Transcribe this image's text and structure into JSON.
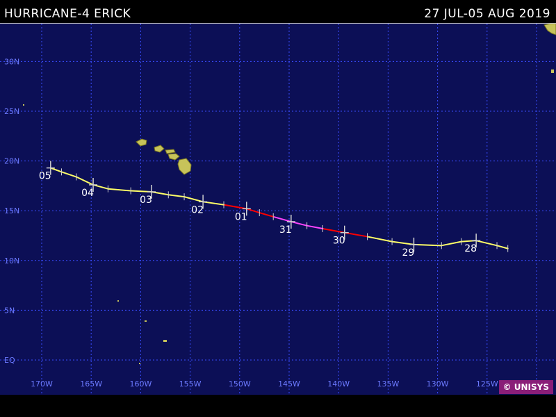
{
  "header": {
    "title": "HURRICANE-4 ERICK",
    "date_range": "27 JUL-05 AUG 2019"
  },
  "credit": "© UNISYS",
  "colors": {
    "ocean": "#0c0f56",
    "grid": "#3a4cff",
    "land": "#c7c35a",
    "hurricane": "#ff0000",
    "category_4": "#ff44ff",
    "tropical_storm": "#ffff66",
    "tropical_depression": "#ffff66"
  },
  "grid": {
    "latitudes": [
      {
        "value": 30,
        "label": "30N"
      },
      {
        "value": 25,
        "label": "25N"
      },
      {
        "value": 20,
        "label": "20N"
      },
      {
        "value": 15,
        "label": "15N"
      },
      {
        "value": 10,
        "label": "10N"
      },
      {
        "value": 5,
        "label": "5N"
      },
      {
        "value": 0,
        "label": "EQ"
      }
    ],
    "longitudes": [
      {
        "value": -170,
        "label": "170W"
      },
      {
        "value": -165,
        "label": "165W"
      },
      {
        "value": -160,
        "label": "160W"
      },
      {
        "value": -155,
        "label": "155W"
      },
      {
        "value": -150,
        "label": "150W"
      },
      {
        "value": -145,
        "label": "145W"
      },
      {
        "value": -140,
        "label": "140W"
      },
      {
        "value": -135,
        "label": "135W"
      },
      {
        "value": -130,
        "label": "130W"
      },
      {
        "value": -125,
        "label": "125W"
      }
    ]
  },
  "track": [
    {
      "lon": -122.9,
      "lat": 11.2,
      "cat": "tropical_depression"
    },
    {
      "lon": -124.0,
      "lat": 11.5,
      "cat": "tropical_storm"
    },
    {
      "lon": -126.1,
      "lat": 12.0,
      "cat": "tropical_storm",
      "day": "28"
    },
    {
      "lon": -127.6,
      "lat": 11.9,
      "cat": "tropical_storm"
    },
    {
      "lon": -129.6,
      "lat": 11.5,
      "cat": "tropical_storm"
    },
    {
      "lon": -132.4,
      "lat": 11.6,
      "cat": "tropical_storm",
      "day": "29"
    },
    {
      "lon": -134.6,
      "lat": 11.9,
      "cat": "tropical_storm"
    },
    {
      "lon": -137.1,
      "lat": 12.4,
      "cat": "tropical_storm"
    },
    {
      "lon": -139.4,
      "lat": 12.8,
      "cat": "hurricane",
      "day": "30"
    },
    {
      "lon": -141.6,
      "lat": 13.2,
      "cat": "hurricane"
    },
    {
      "lon": -143.2,
      "lat": 13.5,
      "cat": "category_4"
    },
    {
      "lon": -144.8,
      "lat": 13.9,
      "cat": "category_4",
      "day": "31"
    },
    {
      "lon": -146.6,
      "lat": 14.4,
      "cat": "category_4"
    },
    {
      "lon": -148.0,
      "lat": 14.8,
      "cat": "hurricane"
    },
    {
      "lon": -149.3,
      "lat": 15.2,
      "cat": "hurricane",
      "day": "01"
    },
    {
      "lon": -151.6,
      "lat": 15.6,
      "cat": "hurricane"
    },
    {
      "lon": -153.7,
      "lat": 15.9,
      "cat": "tropical_storm",
      "day": "02"
    },
    {
      "lon": -155.6,
      "lat": 16.4,
      "cat": "tropical_storm"
    },
    {
      "lon": -157.2,
      "lat": 16.6,
      "cat": "tropical_storm"
    },
    {
      "lon": -158.9,
      "lat": 16.9,
      "cat": "tropical_storm",
      "day": "03"
    },
    {
      "lon": -161.0,
      "lat": 17.0,
      "cat": "tropical_storm"
    },
    {
      "lon": -163.3,
      "lat": 17.2,
      "cat": "tropical_storm"
    },
    {
      "lon": -164.8,
      "lat": 17.6,
      "cat": "tropical_storm",
      "day": "04"
    },
    {
      "lon": -166.5,
      "lat": 18.4,
      "cat": "tropical_depression"
    },
    {
      "lon": -168.0,
      "lat": 18.9,
      "cat": "tropical_depression"
    },
    {
      "lon": -169.1,
      "lat": 19.3,
      "cat": "tropical_depression",
      "day": "05"
    }
  ]
}
